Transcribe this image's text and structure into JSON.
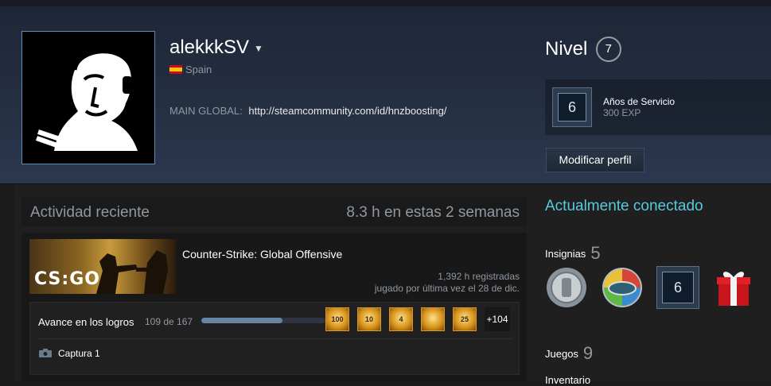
{
  "profile": {
    "username": "alekkkSV",
    "country": "Spain",
    "summary_label": "MAIN GLOBAL:",
    "summary_link": "http://steamcommunity.com/id/hnzboosting/"
  },
  "level": {
    "label": "Nivel",
    "value": "7",
    "favorite_badge": {
      "number": "6",
      "name": "Años de Servicio",
      "xp": "300 EXP"
    },
    "edit_button": "Modificar perfil"
  },
  "activity": {
    "title": "Actividad reciente",
    "hours_summary": "8.3 h en estas 2 semanas",
    "game": {
      "capsule_logo": "CS:GO",
      "name": "Counter-Strike: Global Offensive",
      "hours": "1,392 h registradas",
      "last_played": "jugado por última vez el 28 de dic."
    },
    "achievements": {
      "label": "Avance en los logros",
      "count": "109 de 167",
      "progress_fraction": 0.653,
      "icons": [
        "100",
        "10",
        "4",
        "",
        "25"
      ],
      "more": "+104"
    },
    "screenshot_label": "Captura 1"
  },
  "sidebar": {
    "status": "Actualmente conectado",
    "badges_label": "Insignias",
    "badges_count": "5",
    "badge_items": [
      "coin-badge",
      "multicolor-badge",
      "years-of-service-badge",
      "gift-badge"
    ],
    "badge_six": "6",
    "games_label": "Juegos",
    "games_count": "9",
    "inventory_label": "Inventario"
  }
}
